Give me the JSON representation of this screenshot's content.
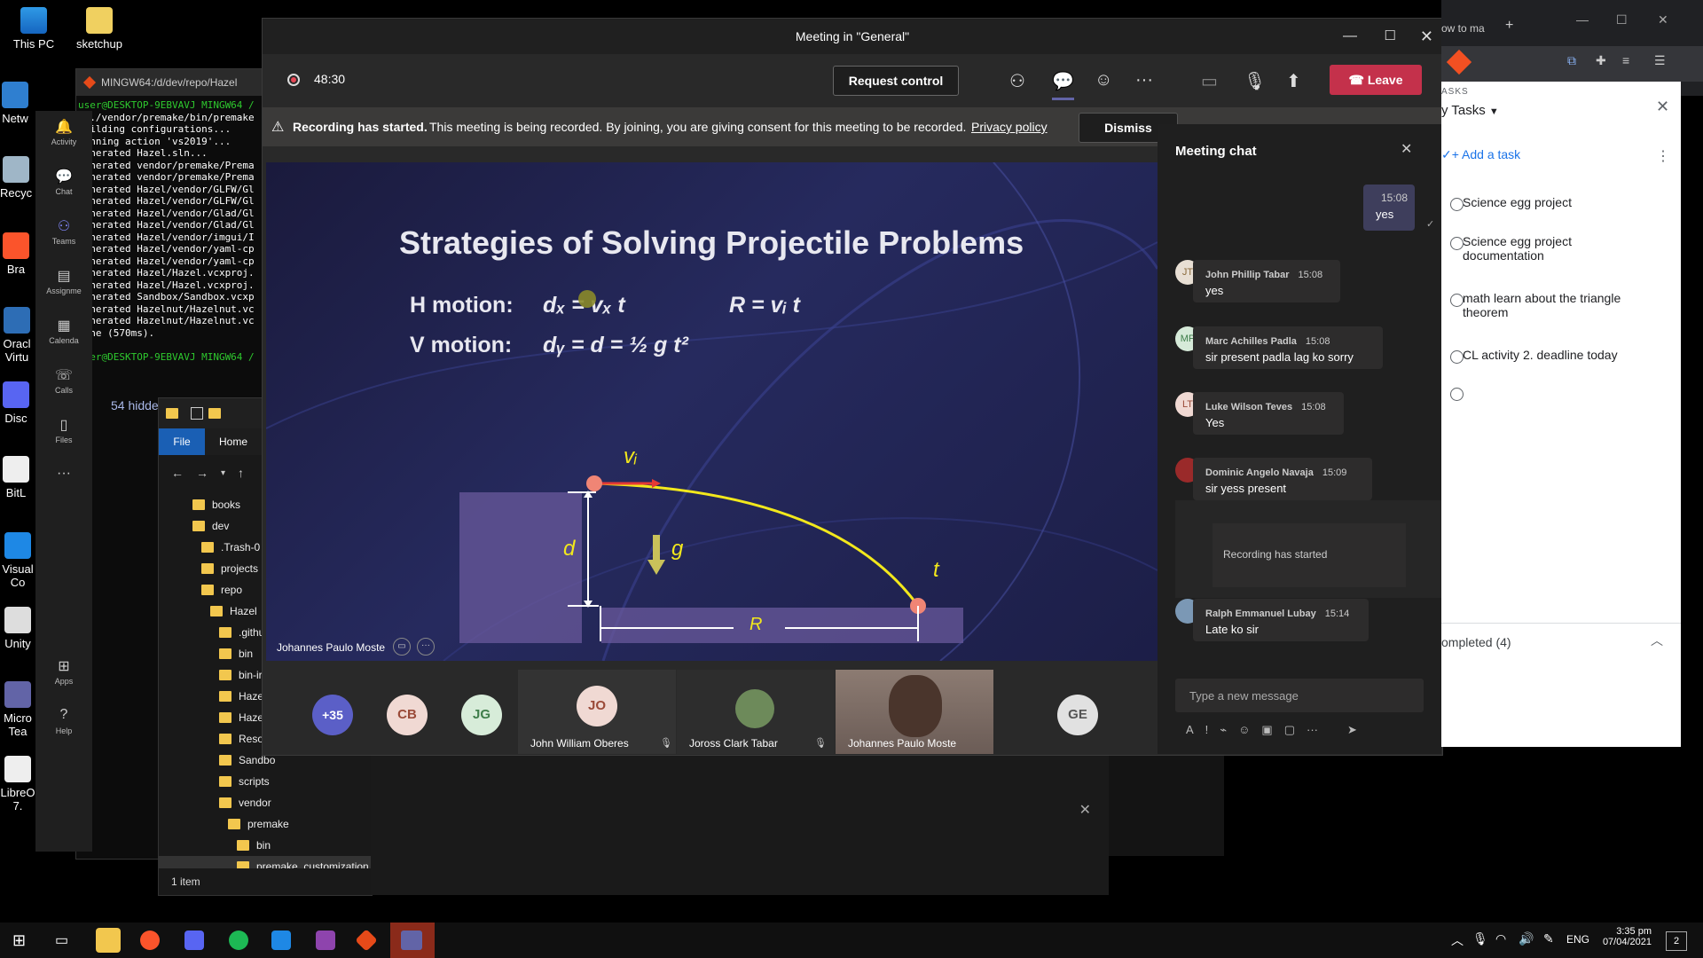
{
  "desktop": {
    "icons": [
      {
        "label": "This PC"
      },
      {
        "label": "sketchup"
      },
      {
        "label": "Netw"
      },
      {
        "label": "Recyc"
      },
      {
        "label": "Bra"
      },
      {
        "label": "Oracl Virtu"
      },
      {
        "label": "Disc"
      },
      {
        "label": "BitL"
      },
      {
        "label": "Visual Co"
      },
      {
        "label": "Unity"
      },
      {
        "label": "Micro Tea"
      },
      {
        "label": "LibreO 7."
      }
    ]
  },
  "terminal": {
    "title": "MINGW64:/d/dev/repo/Hazel",
    "lines": [
      {
        "text": "user@DESKTOP-9EBVAVJ MINGW64 /",
        "cls": "green"
      },
      {
        "text": "$ ./vendor/premake/bin/premake",
        "cls": ""
      },
      {
        "text": "Building configurations...",
        "cls": ""
      },
      {
        "text": "Running action 'vs2019'...",
        "cls": ""
      },
      {
        "text": "Generated Hazel.sln...",
        "cls": ""
      },
      {
        "text": "Generated vendor/premake/Prema",
        "cls": ""
      },
      {
        "text": "Generated vendor/premake/Prema",
        "cls": ""
      },
      {
        "text": "Generated Hazel/vendor/GLFW/Gl",
        "cls": ""
      },
      {
        "text": "Generated Hazel/vendor/GLFW/Gl",
        "cls": ""
      },
      {
        "text": "Generated Hazel/vendor/Glad/Gl",
        "cls": ""
      },
      {
        "text": "Generated Hazel/vendor/Glad/Gl",
        "cls": ""
      },
      {
        "text": "Generated Hazel/vendor/imgui/I",
        "cls": ""
      },
      {
        "text": "Generated Hazel/vendor/yaml-cp",
        "cls": ""
      },
      {
        "text": "Generated Hazel/vendor/yaml-cp",
        "cls": ""
      },
      {
        "text": "Generated Hazel/Hazel.vcxproj.",
        "cls": ""
      },
      {
        "text": "Generated Hazel/Hazel.vcxproj.",
        "cls": ""
      },
      {
        "text": "Generated Sandbox/Sandbox.vcxp",
        "cls": ""
      },
      {
        "text": "Generated Hazelnut/Hazelnut.vc",
        "cls": ""
      },
      {
        "text": "Generated Hazelnut/Hazelnut.vc",
        "cls": ""
      },
      {
        "text": "Done (570ms).",
        "cls": ""
      },
      {
        "text": "",
        "cls": ""
      },
      {
        "text": "user@DESKTOP-9EBVAVJ MINGW64 /",
        "cls": "green"
      },
      {
        "text": "$",
        "cls": ""
      }
    ]
  },
  "teams_rail": {
    "items": [
      {
        "label": "Activity",
        "icon": "bell-icon"
      },
      {
        "label": "Chat",
        "icon": "chat-icon"
      },
      {
        "label": "Teams",
        "icon": "teams-icon"
      },
      {
        "label": "Assignme",
        "icon": "assignment-icon"
      },
      {
        "label": "Calenda",
        "icon": "calendar-icon"
      },
      {
        "label": "Calls",
        "icon": "phone-icon"
      },
      {
        "label": "Files",
        "icon": "file-icon"
      },
      {
        "label": "Apps",
        "icon": "apps-icon"
      },
      {
        "label": "Help",
        "icon": "help-icon"
      }
    ],
    "hidden_label": "54 hidde"
  },
  "explorer": {
    "tabs": [
      "File",
      "Home"
    ],
    "folders": [
      {
        "label": "books",
        "indent": 0
      },
      {
        "label": "dev",
        "indent": 0
      },
      {
        "label": ".Trash-0",
        "indent": 1
      },
      {
        "label": "projects",
        "indent": 1
      },
      {
        "label": "repo",
        "indent": 1
      },
      {
        "label": "Hazel",
        "indent": 2
      },
      {
        "label": ".githu",
        "indent": 3
      },
      {
        "label": "bin",
        "indent": 3
      },
      {
        "label": "bin-ir",
        "indent": 3
      },
      {
        "label": "Hazel",
        "indent": 3
      },
      {
        "label": "Hazel",
        "indent": 3
      },
      {
        "label": "Resou",
        "indent": 3
      },
      {
        "label": "Sandbo",
        "indent": 3
      },
      {
        "label": "scripts",
        "indent": 3
      },
      {
        "label": "vendor",
        "indent": 3
      },
      {
        "label": "premake",
        "indent": 4
      },
      {
        "label": "bin",
        "indent": 5
      },
      {
        "label": "premake_customization",
        "indent": 5
      }
    ],
    "status": "1 item"
  },
  "meeting": {
    "title": "Meeting in \"General\"",
    "timer": "48:30",
    "request_control": "Request control",
    "leave": "Leave",
    "banner_bold": "Recording has started.",
    "banner_text": "This meeting is being recorded. By joining, you are giving consent for this meeting to be recorded.",
    "privacy": "Privacy policy",
    "dismiss": "Dismiss",
    "presenter": "Johannes Paulo Moste"
  },
  "slide": {
    "title": "Strategies of Solving Projectile Problems",
    "h_label": "H motion:",
    "v_label": "V motion:",
    "h_eq": "dₓ = vₓ t",
    "r_eq": "R = vᵢ t",
    "v_eq": "dᵧ = d = ½ g t²",
    "vi": "vᵢ",
    "d": "d",
    "g": "g",
    "t": "t",
    "r": "R"
  },
  "chat": {
    "title": "Meeting chat",
    "self_msg": {
      "time": "15:08",
      "text": "yes"
    },
    "messages": [
      {
        "initials": "JT",
        "name": "John Phillip Tabar",
        "time": "15:08",
        "text": "yes"
      },
      {
        "initials": "MP",
        "name": "Marc Achilles Padla",
        "time": "15:08",
        "text": "sir present padla lag ko sorry"
      },
      {
        "initials": "LT",
        "name": "Luke Wilson Teves",
        "time": "15:08",
        "text": "Yes"
      },
      {
        "initials": "",
        "name": "Dominic Angelo Navaja",
        "time": "15:09",
        "text": "sir yess present"
      },
      {
        "initials": "",
        "name": "Ralph Emmanuel Lubay",
        "time": "15:14",
        "text": "Late ko sir"
      }
    ],
    "system": "Recording has started",
    "input_placeholder": "Type a new message"
  },
  "participants": {
    "more": "+35",
    "bubbles": [
      {
        "initials": "CB",
        "bg": "#f0d9d3",
        "fg": "#9a4a38"
      },
      {
        "initials": "JG",
        "bg": "#d7ecd9",
        "fg": "#3e7d4a"
      }
    ],
    "tiles": [
      {
        "initials": "JO",
        "name": "John William Oberes"
      },
      {
        "initials": "",
        "name": "Joross Clark Tabar"
      },
      {
        "initials": "",
        "name": "Johannes Paulo Moste"
      }
    ],
    "last": "GE"
  },
  "tasks": {
    "header": "ASKS",
    "list_title": "y Tasks",
    "add": "Add a task",
    "items": [
      "Science egg project",
      "Science egg project documentation",
      "math learn about the triangle theorem",
      "CL activity 2. deadline today",
      ""
    ],
    "completed": "ompleted (4)",
    "browser_tab": "ow to ma"
  },
  "taskbar": {
    "lang": "ENG",
    "time": "3:35 pm",
    "date": "07/04/2021",
    "notif": "2"
  },
  "colors": {
    "leave": "#c4314b",
    "accent": "#6264a7",
    "slide_title": "#e8e8f0"
  }
}
